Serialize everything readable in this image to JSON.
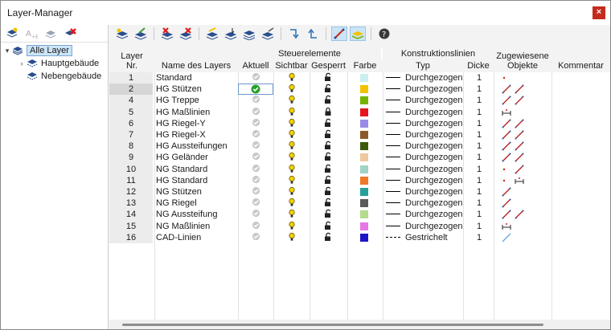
{
  "window": {
    "title": "Layer-Manager",
    "close_label": "×"
  },
  "tree": {
    "root": "Alle Layer",
    "children": [
      "Hauptgebäude",
      "Nebengebäude"
    ]
  },
  "columns": {
    "layer_nr_1": "Layer",
    "layer_nr_2": "Nr.",
    "name": "Name des Layers",
    "group_steuer": "Steuerelemente",
    "aktuell": "Aktuell",
    "sichtbar": "Sichtbar",
    "gesperrt": "Gesperrt",
    "farbe": "Farbe",
    "group_konstr": "Konstruktionslinien",
    "typ": "Typ",
    "dicke": "Dicke",
    "obj_1": "Zugewiesene",
    "obj_2": "Objekte",
    "kommentar": "Kommentar"
  },
  "rows": [
    {
      "nr": "1",
      "name": "Standard",
      "color": "#c9f0ef",
      "typ": "Durchgezogen",
      "dicke": "1",
      "locked": false,
      "objects": "dot"
    },
    {
      "nr": "2",
      "name": "HG Stützen",
      "color": "#f2c200",
      "typ": "Durchgezogen",
      "dicke": "1",
      "locked": false,
      "objects": "line-line",
      "current": true
    },
    {
      "nr": "4",
      "name": "HG Treppe",
      "color": "#74b400",
      "typ": "Durchgezogen",
      "dicke": "1",
      "locked": false,
      "objects": "line-line"
    },
    {
      "nr": "5",
      "name": "HG Maßlinien",
      "color": "#e6141e",
      "typ": "Durchgezogen",
      "dicke": "1",
      "locked": true,
      "objects": "dim"
    },
    {
      "nr": "6",
      "name": "HG Riegel-Y",
      "color": "#9a8ce6",
      "typ": "Durchgezogen",
      "dicke": "1",
      "locked": false,
      "objects": "line-line"
    },
    {
      "nr": "7",
      "name": "HG Riegel-X",
      "color": "#8c5a28",
      "typ": "Durchgezogen",
      "dicke": "1",
      "locked": false,
      "objects": "line-line"
    },
    {
      "nr": "8",
      "name": "HG Aussteifungen",
      "color": "#3c5a0a",
      "typ": "Durchgezogen",
      "dicke": "1",
      "locked": false,
      "objects": "line-line"
    },
    {
      "nr": "9",
      "name": "HG Geländer",
      "color": "#f0c8a0",
      "typ": "Durchgezogen",
      "dicke": "1",
      "locked": false,
      "objects": "line-line"
    },
    {
      "nr": "10",
      "name": "NG Standard",
      "color": "#a0d2c8",
      "typ": "Durchgezogen",
      "dicke": "1",
      "locked": false,
      "objects": "dot-line"
    },
    {
      "nr": "11",
      "name": "HG Standard",
      "color": "#f07828",
      "typ": "Durchgezogen",
      "dicke": "1",
      "locked": false,
      "objects": "dot-dim"
    },
    {
      "nr": "12",
      "name": "NG Stützen",
      "color": "#28a09a",
      "typ": "Durchgezogen",
      "dicke": "1",
      "locked": false,
      "objects": "line"
    },
    {
      "nr": "13",
      "name": "NG Riegel",
      "color": "#5a5a5a",
      "typ": "Durchgezogen",
      "dicke": "1",
      "locked": false,
      "objects": "line"
    },
    {
      "nr": "14",
      "name": "NG Aussteifung",
      "color": "#b4dc8c",
      "typ": "Durchgezogen",
      "dicke": "1",
      "locked": false,
      "objects": "line-line"
    },
    {
      "nr": "15",
      "name": "NG Maßlinien",
      "color": "#e678e6",
      "typ": "Durchgezogen",
      "dicke": "1",
      "locked": false,
      "objects": "dim"
    },
    {
      "nr": "16",
      "name": "CAD-Linien",
      "color": "#1e14c8",
      "typ": "Gestrichelt",
      "dicke": "1",
      "locked": false,
      "objects": "blueline",
      "dashed": true
    }
  ]
}
